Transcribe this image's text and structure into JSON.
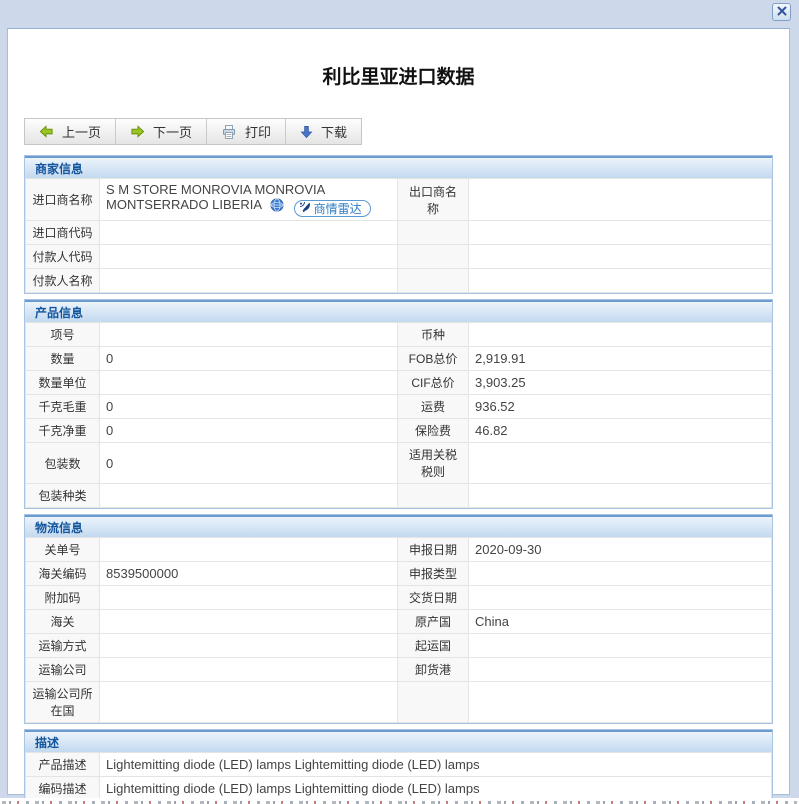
{
  "window": {
    "close_icon": "close-icon"
  },
  "dialog": {
    "title": "利比里亚进口数据"
  },
  "toolbar": {
    "buttons": [
      {
        "label": "上一页",
        "icon": "green-left-arrow-icon"
      },
      {
        "label": "下一页",
        "icon": "green-right-arrow-icon"
      },
      {
        "label": "打印",
        "icon": "printer-icon"
      },
      {
        "label": "下载",
        "icon": "blue-down-arrow-icon"
      }
    ]
  },
  "sections": {
    "merchant": {
      "title": "商家信息",
      "radar_badge_label": "商情雷达",
      "rows": [
        {
          "l1": "进口商名称",
          "v1": "S M STORE MONROVIA MONROVIA MONTSERRADO LIBERIA",
          "l2": "出口商名称",
          "v2": ""
        },
        {
          "l1": "进口商代码",
          "v1": "",
          "l2": "",
          "v2": ""
        },
        {
          "l1": "付款人代码",
          "v1": "",
          "l2": "",
          "v2": ""
        },
        {
          "l1": "付款人名称",
          "v1": "",
          "l2": "",
          "v2": ""
        }
      ]
    },
    "product": {
      "title": "产品信息",
      "rows": [
        {
          "l1": "项号",
          "v1": "",
          "l2": "币种",
          "v2": ""
        },
        {
          "l1": "数量",
          "v1": "0",
          "l2": "FOB总价",
          "v2": "2,919.91"
        },
        {
          "l1": "数量单位",
          "v1": "",
          "l2": "CIF总价",
          "v2": "3,903.25"
        },
        {
          "l1": "千克毛重",
          "v1": "0",
          "l2": "运费",
          "v2": "936.52"
        },
        {
          "l1": "千克净重",
          "v1": "0",
          "l2": "保险费",
          "v2": "46.82"
        },
        {
          "l1": "包装数",
          "v1": "0",
          "l2": "适用关税税则",
          "v2": ""
        },
        {
          "l1": "包装种类",
          "v1": "",
          "l2": "",
          "v2": ""
        }
      ]
    },
    "logistics": {
      "title": "物流信息",
      "rows": [
        {
          "l1": "关单号",
          "v1": "",
          "l2": "申报日期",
          "v2": "2020-09-30"
        },
        {
          "l1": "海关编码",
          "v1": "8539500000",
          "l2": "申报类型",
          "v2": ""
        },
        {
          "l1": "附加码",
          "v1": "",
          "l2": "交货日期",
          "v2": ""
        },
        {
          "l1": "海关",
          "v1": "",
          "l2": "原产国",
          "v2": "China"
        },
        {
          "l1": "运输方式",
          "v1": "",
          "l2": "起运国",
          "v2": ""
        },
        {
          "l1": "运输公司",
          "v1": "",
          "l2": "卸货港",
          "v2": ""
        },
        {
          "l1": "运输公司所在国",
          "v1": "",
          "l2": "",
          "v2": ""
        }
      ]
    },
    "description": {
      "title": "描述",
      "rows": [
        {
          "l": "产品描述",
          "v": "Lightemitting diode (LED) lamps Lightemitting diode (LED) lamps"
        },
        {
          "l": "编码描述",
          "v": "Lightemitting diode (LED) lamps Lightemitting diode (LED) lamps"
        }
      ]
    }
  },
  "icons": {
    "close": "close-icon",
    "prev": "green-left-arrow-icon",
    "next": "green-right-arrow-icon",
    "print": "printer-icon",
    "download": "blue-down-arrow-icon",
    "globe": "globe-icon",
    "radar": "radar-dish-icon"
  },
  "colors": {
    "page_bg": "#cdd9ea",
    "section_border": "#a9c4e3",
    "section_header_text": "#13559c",
    "section_header_grad_top": "#ecf4fc",
    "section_header_grad_bottom": "#c3d9f0",
    "toolbar_green": "#9ac520",
    "toolbar_blue": "#4876c8",
    "badge_blue": "#2e7cc3"
  }
}
